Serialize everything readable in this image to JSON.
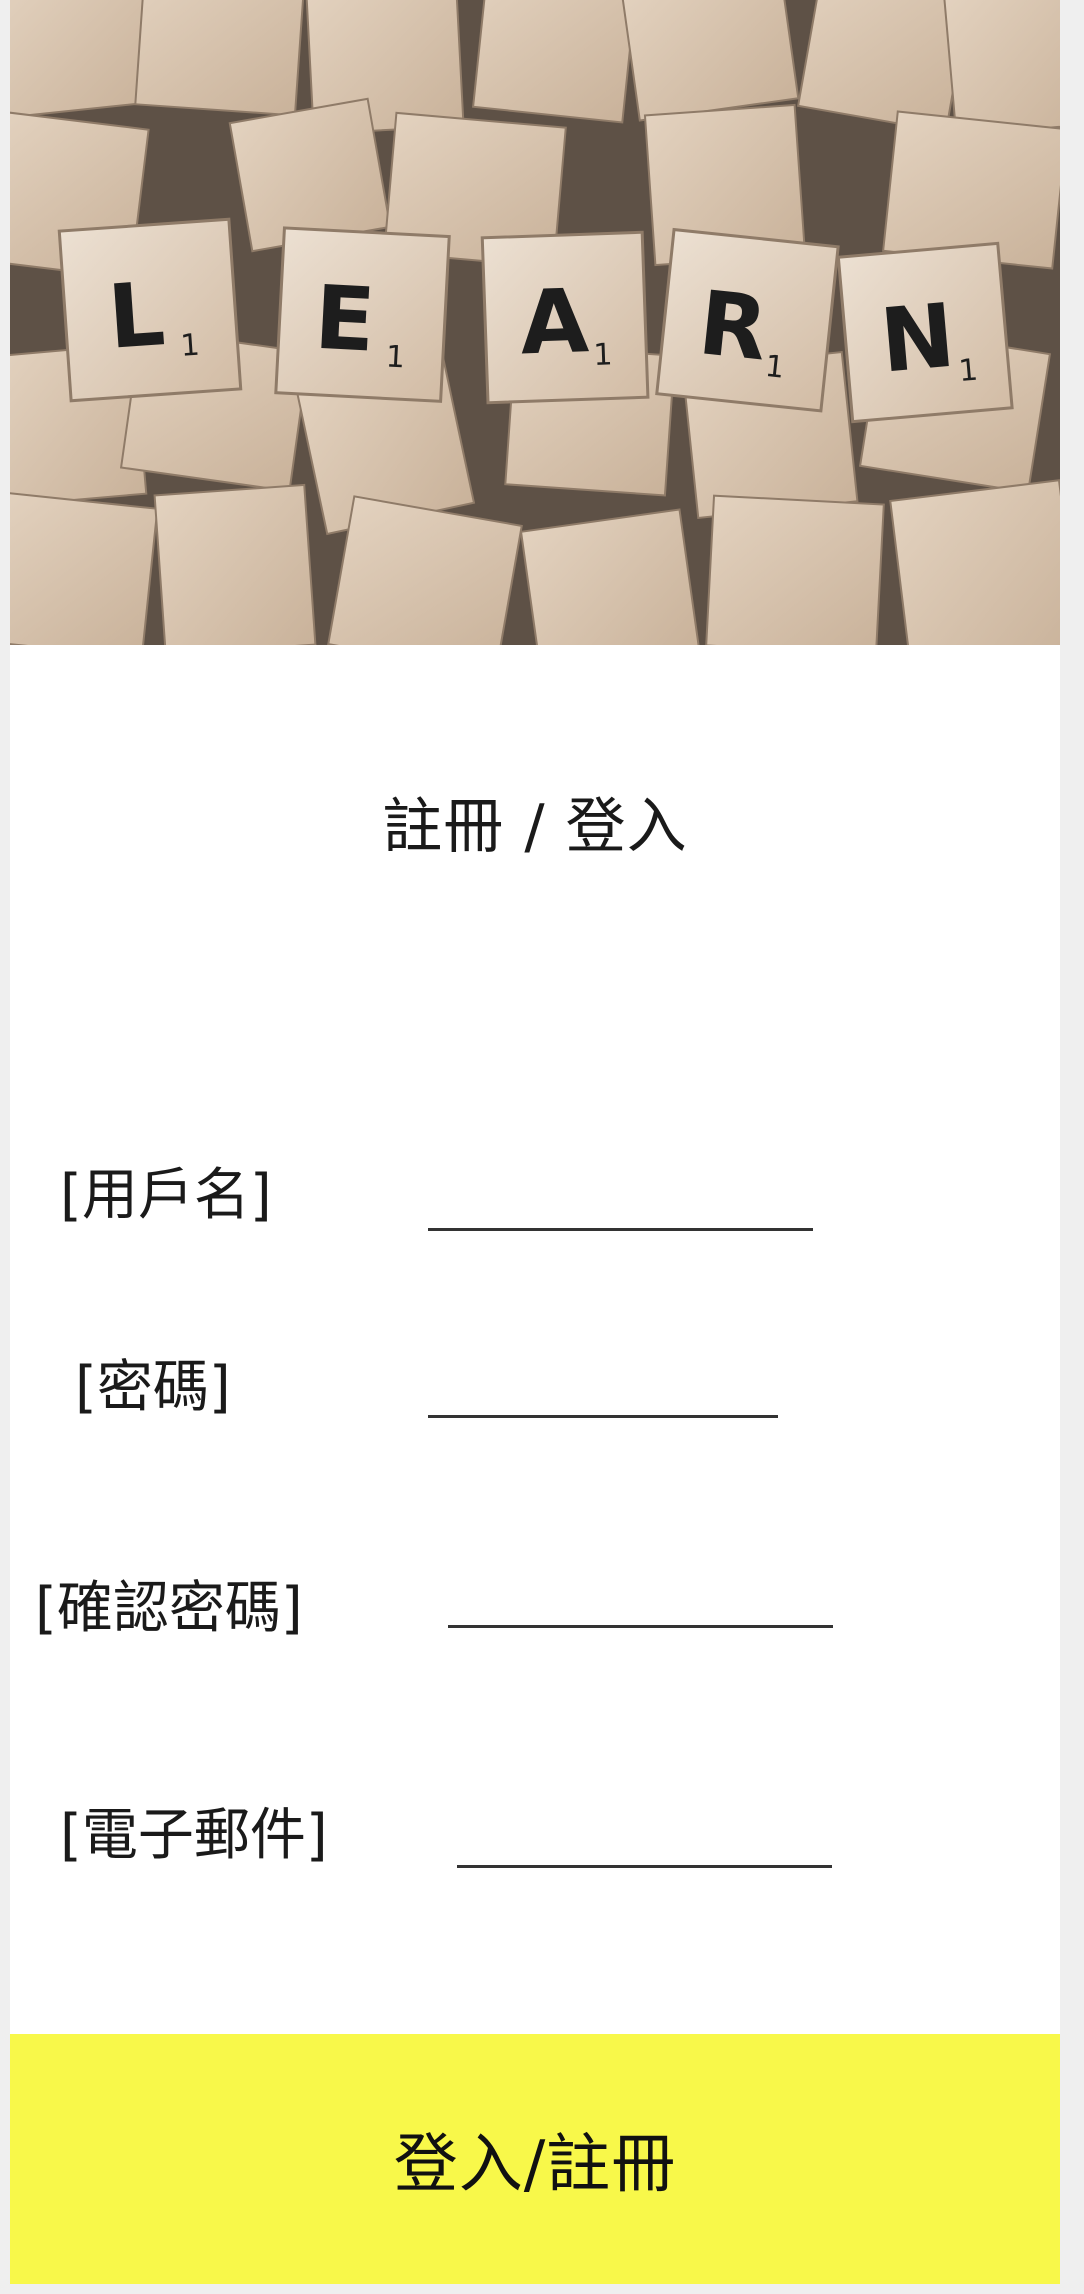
{
  "hero": {
    "image": "scrabble-tiles-photo",
    "tiles": [
      {
        "letter": "L",
        "value": "1"
      },
      {
        "letter": "E",
        "value": "1"
      },
      {
        "letter": "A",
        "value": "1"
      },
      {
        "letter": "R",
        "value": "1"
      },
      {
        "letter": "N",
        "value": "1"
      }
    ]
  },
  "title": "註冊 / 登入",
  "form": {
    "username_label": "[用戶名]",
    "password_label": "[密碼]",
    "confirm_password_label": "[確認密碼]",
    "email_label": "[電子郵件]",
    "username_value": "",
    "password_value": "",
    "confirm_password_value": "",
    "email_value": ""
  },
  "submit_label": "登入/註冊",
  "colors": {
    "button_bg": "#f8f84a",
    "tile_wood": "#d9c4ae",
    "background": "#ffffff"
  }
}
